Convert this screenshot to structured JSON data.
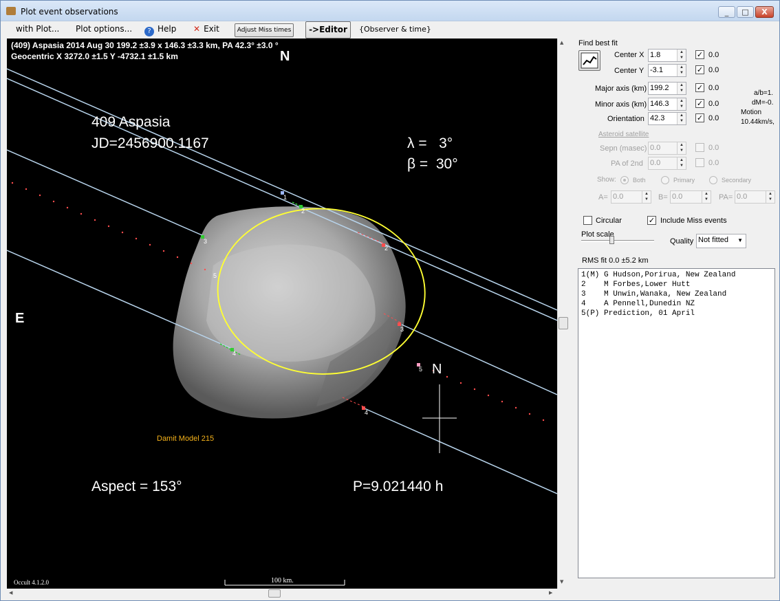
{
  "window": {
    "title": "Plot event observations",
    "min": "_",
    "max": "□",
    "close": "X"
  },
  "menu": {
    "with_plot": "with Plot...",
    "plot_options": "Plot options...",
    "help": "Help",
    "exit": "Exit",
    "adjust_miss": "Adjust Miss times",
    "editor": "->Editor",
    "observer_time": "{Observer & time}"
  },
  "plot": {
    "header_line1": "(409) Aspasia  2014 Aug 30   199.2 ±3.9 x 146.3 ±3.3 km,  PA 42.3° ±3.0 °",
    "header_line2": "Geocentric  X  3272.0 ±1.5  Y -4732.1 ±1.5 km",
    "north_top": "N",
    "east": "E",
    "asteroid_name": "409 Aspasia",
    "jd": "JD=2456900.1167",
    "lambda": "λ =   3°",
    "beta": "β =  30°",
    "model": "Damit Model 215",
    "aspect": "Aspect = 153°",
    "period": "P=9.021440 h",
    "north_arrow": "N",
    "scale_label": "100 km.",
    "version": "Occult 4.1.2.0",
    "chord_labels": [
      "1",
      "2",
      "2",
      "3",
      "3",
      "4",
      "4",
      "5",
      "5"
    ]
  },
  "panel": {
    "find_best_fit": "Find best fit",
    "center_x": {
      "label": "Center X",
      "value": "1.8",
      "fixed": "0.0"
    },
    "center_y": {
      "label": "Center Y",
      "value": "-3.1",
      "fixed": "0.0"
    },
    "major_axis": {
      "label": "Major axis (km)",
      "value": "199.2",
      "fixed": "0.0"
    },
    "minor_axis": {
      "label": "Minor axis (km)",
      "value": "146.3",
      "fixed": "0.0"
    },
    "orientation": {
      "label": "Orientation",
      "value": "42.3",
      "fixed": "0.0"
    },
    "ab_ratio": "a/b=1.",
    "dm": "dM=-0.",
    "motion_label": "Motion",
    "motion_value": "10.44km/s,",
    "satellite_header": "Asteroid satellite",
    "sepn": {
      "label": "Sepn (masec)",
      "value": "0.0",
      "fixed": "0.0"
    },
    "pa2": {
      "label": "PA of 2nd",
      "value": "0.0",
      "fixed": "0.0"
    },
    "show": "Show:",
    "show_both": "Both",
    "show_primary": "Primary",
    "show_secondary": "Secondary",
    "a_label": "A=",
    "a_value": "0.0",
    "b_label": "B=",
    "b_value": "0.0",
    "pa_label": "PA=",
    "pa_value": "0.0",
    "circular": "Circular",
    "include_miss": "Include Miss events",
    "plot_scale": "Plot scale",
    "quality_label": "Quality",
    "quality_value": "Not fitted",
    "rms": "RMS fit 0.0 ±5.2 km",
    "observers": [
      "1(M) G Hudson,Porirua, New Zealand",
      "2    M Forbes,Lower Hutt",
      "3    M Unwin,Wanaka, New Zealand",
      "4    A Pennell,Dunedin NZ",
      "5(P) Prediction, 01 April"
    ]
  },
  "colors": {
    "canvas": "#000000",
    "chord": "#b8d4ec",
    "ellipse": "#ffff33",
    "model_text": "#f5b21a",
    "miss_dot": "#ff4d4d"
  }
}
